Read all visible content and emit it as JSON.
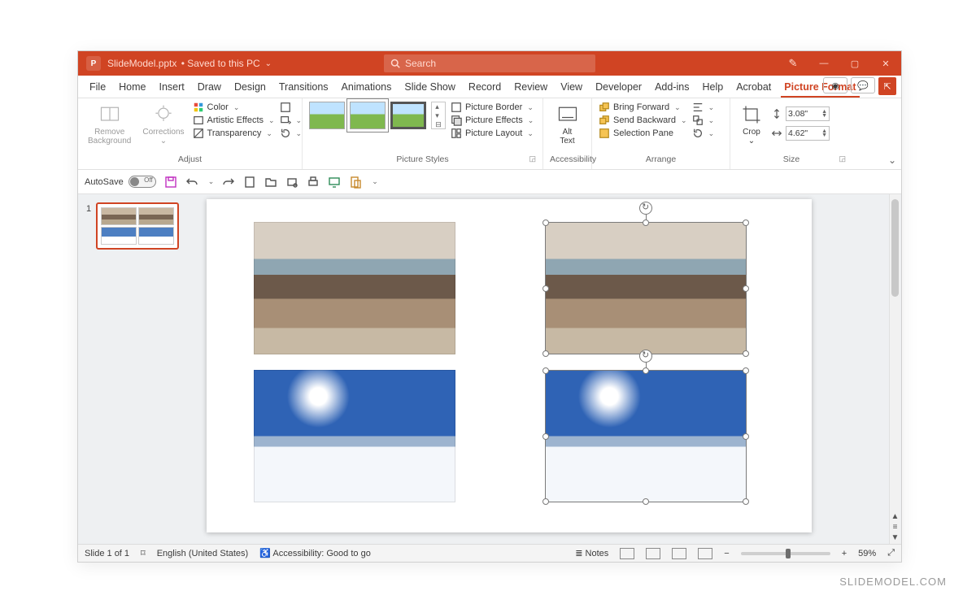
{
  "title": {
    "app_icon": "P",
    "filename": "SlideModel.pptx",
    "save_status": "Saved to this PC",
    "search_placeholder": "Search"
  },
  "tabs": [
    "File",
    "Home",
    "Insert",
    "Draw",
    "Design",
    "Transitions",
    "Animations",
    "Slide Show",
    "Record",
    "Review",
    "View",
    "Developer",
    "Add-ins",
    "Help",
    "Acrobat",
    "Picture Format"
  ],
  "active_tab": "Picture Format",
  "ribbon": {
    "adjust": {
      "remove_bg": "Remove\nBackground",
      "corrections": "Corrections",
      "color": "Color",
      "artistic": "Artistic Effects",
      "transparency": "Transparency",
      "group_label": "Adjust"
    },
    "styles": {
      "border": "Picture Border",
      "effects": "Picture Effects",
      "layout": "Picture Layout",
      "group_label": "Picture Styles"
    },
    "accessibility": {
      "alt_text": "Alt\nText",
      "group_label": "Accessibility"
    },
    "arrange": {
      "forward": "Bring Forward",
      "backward": "Send Backward",
      "selection": "Selection Pane",
      "group_label": "Arrange"
    },
    "size": {
      "crop": "Crop",
      "height": "3.08\"",
      "width": "4.62\"",
      "group_label": "Size"
    }
  },
  "qat": {
    "autosave_label": "AutoSave",
    "autosave_state": "Off"
  },
  "thumb": {
    "number": "1"
  },
  "status": {
    "slide": "Slide 1 of 1",
    "language": "English (United States)",
    "accessibility": "Accessibility: Good to go",
    "notes": "Notes",
    "zoom": "59%"
  },
  "watermark": "SLIDEMODEL.COM"
}
